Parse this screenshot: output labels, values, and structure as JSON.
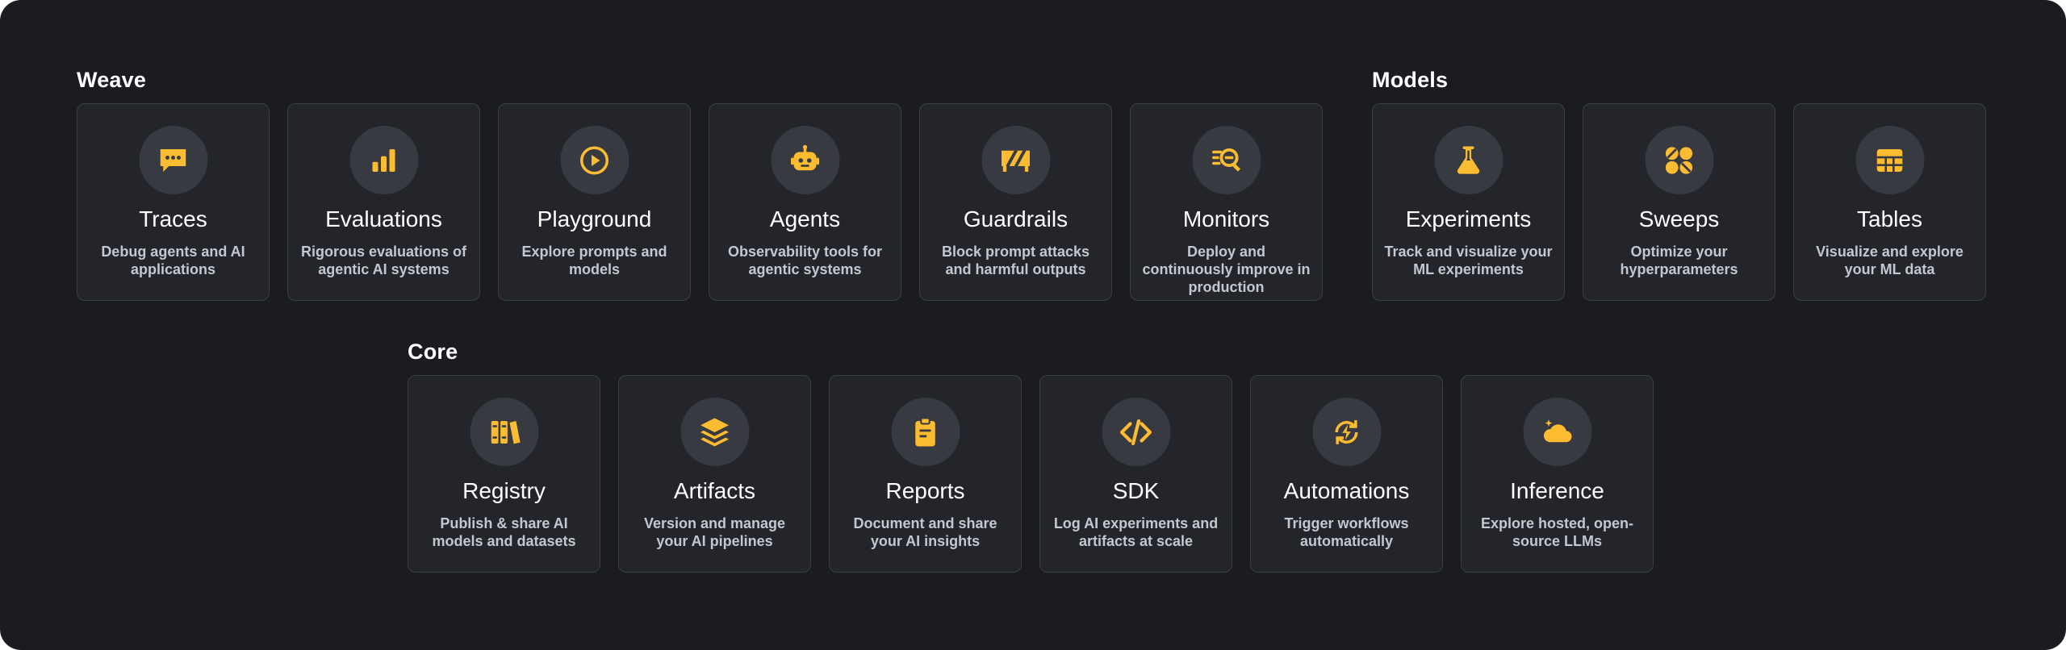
{
  "colors": {
    "background": "#1a1c21",
    "card": "#23252b",
    "card_border": "#3b3e46",
    "icon_bg": "#383a42",
    "accent": "#fcbc32"
  },
  "weave": {
    "title": "Weave",
    "cards": [
      {
        "title": "Traces",
        "desc": "Debug agents and AI applications",
        "icon": "chat-bubble-icon"
      },
      {
        "title": "Evaluations",
        "desc": "Rigorous evaluations of agentic AI systems",
        "icon": "bar-chart-icon"
      },
      {
        "title": "Playground",
        "desc": "Explore prompts and models",
        "icon": "play-circle-icon"
      },
      {
        "title": "Agents",
        "desc": "Observability tools for agentic systems",
        "icon": "robot-icon"
      },
      {
        "title": "Guardrails",
        "desc": "Block prompt attacks and harmful outputs",
        "icon": "barrier-icon"
      },
      {
        "title": "Monitors",
        "desc": "Deploy and continuously improve in production",
        "icon": "monitor-search-icon"
      }
    ]
  },
  "models": {
    "title": "Models",
    "cards": [
      {
        "title": "Experiments",
        "desc": "Track and visualize your ML experiments",
        "icon": "flask-icon"
      },
      {
        "title": "Sweeps",
        "desc": "Optimize your hyperparameters",
        "icon": "sweeps-icon"
      },
      {
        "title": "Tables",
        "desc": "Visualize and explore your ML data",
        "icon": "table-grid-icon"
      }
    ]
  },
  "core": {
    "title": "Core",
    "cards": [
      {
        "title": "Registry",
        "desc": "Publish & share AI models and datasets",
        "icon": "books-icon"
      },
      {
        "title": "Artifacts",
        "desc": "Version and manage your AI pipelines",
        "icon": "layers-icon"
      },
      {
        "title": "Reports",
        "desc": "Document and share your AI insights",
        "icon": "clipboard-icon"
      },
      {
        "title": "SDK",
        "desc": "Log AI experiments and artifacts at scale",
        "icon": "code-icon"
      },
      {
        "title": "Automations",
        "desc": "Trigger workflows automatically",
        "icon": "lightning-cycle-icon"
      },
      {
        "title": "Inference",
        "desc": "Explore hosted, open-source LLMs",
        "icon": "cloud-sparkle-icon"
      }
    ]
  }
}
